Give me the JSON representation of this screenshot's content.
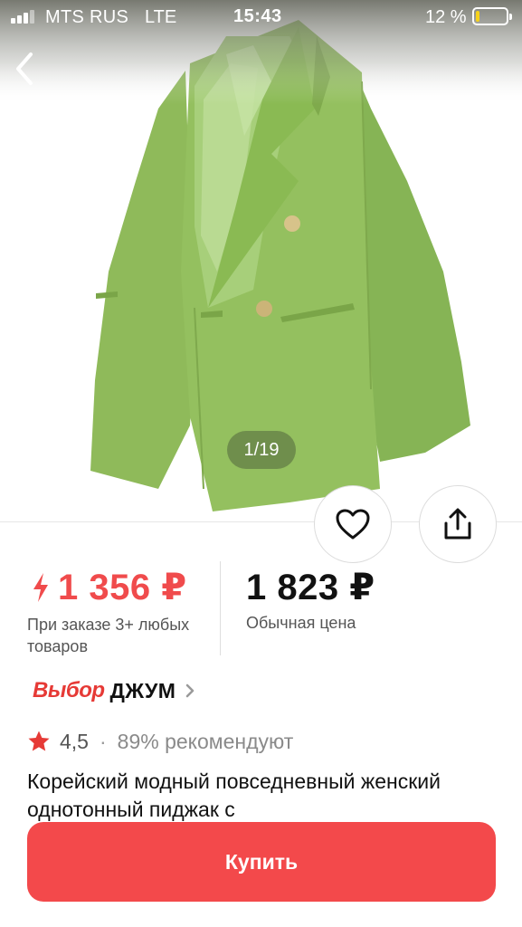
{
  "status_bar": {
    "carrier": "MTS RUS",
    "network": "LTE",
    "time": "15:43",
    "battery_percent": "12 %",
    "battery_level": 0.12,
    "battery_color": "#f6d21b",
    "signal_bars": 3
  },
  "gallery": {
    "counter": "1/19",
    "current": 1,
    "total": 19,
    "back_icon": "chevron-left-icon",
    "favorite_icon": "heart-icon",
    "share_icon": "share-icon"
  },
  "price": {
    "promo_price": "1 356 ₽",
    "promo_note": "При заказе 3+ любых товаров",
    "regular_price": "1 823 ₽",
    "regular_note": "Обычная цена",
    "promo_icon": "lightning-icon",
    "promo_color": "#f04b4c"
  },
  "brand": {
    "choice_label": "Выбор",
    "name": "ДЖУМ",
    "chevron_icon": "chevron-right-icon"
  },
  "rating": {
    "value": "4,5",
    "separator": "·",
    "recommend": "89% рекомендуют",
    "star_icon": "star-icon"
  },
  "product": {
    "title": "Корейский модный повседневный женский однотонный пиджак с"
  },
  "actions": {
    "buy_label": "Купить",
    "buy_color": "#f3494b"
  }
}
